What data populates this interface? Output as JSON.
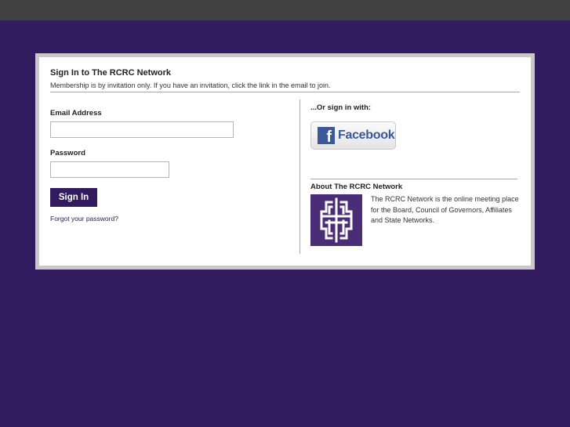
{
  "signin": {
    "title": "Sign In to The RCRC Network",
    "subtitle": "Membership is by invitation only. If you have an invitation, click the link in the email to join.",
    "email_label": "Email Address",
    "email_value": "",
    "password_label": "Password",
    "password_value": "",
    "signin_button": "Sign In",
    "forgot_link": "Forgot your password?"
  },
  "social": {
    "or_sign_label": "...Or sign in with:",
    "facebook_label": "Facebook",
    "facebook_icon": "f"
  },
  "about": {
    "title": "About The RCRC Network",
    "description": "The RCRC Network is the online meeting place for the Board, Council of Governors, Affiliates and State Networks."
  },
  "colors": {
    "page_background": "#331b5f",
    "top_bar": "#404040",
    "button": "#331b5f",
    "facebook": "#3b5998"
  }
}
